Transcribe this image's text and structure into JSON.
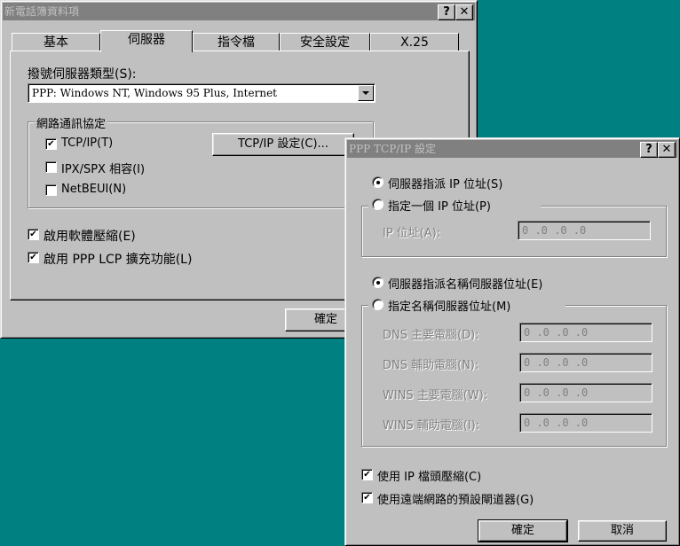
{
  "main_window": {
    "title": "新電話簿資料項",
    "help_label": "?",
    "close_label": "✕",
    "tabs": [
      {
        "label": "基本",
        "active": false
      },
      {
        "label": "伺服器",
        "active": true
      },
      {
        "label": "指令檔",
        "active": false
      },
      {
        "label": "安全設定",
        "active": false
      },
      {
        "label": "X.25",
        "active": false
      }
    ],
    "server_type_label": "撥號伺服器類型(S):",
    "server_type_value": "PPP: Windows NT, Windows 95 Plus, Internet",
    "protocol_group_label": "網路通訊協定",
    "protocols": [
      {
        "label": "TCP/IP(T)",
        "checked": true
      },
      {
        "label": "IPX/SPX 相容(I)",
        "checked": false
      },
      {
        "label": "NetBEUI(N)",
        "checked": false
      }
    ],
    "tcpip_settings_button": "TCP/IP 設定(C)...",
    "software_compression": {
      "label": "啟用軟體壓縮(E)",
      "checked": true
    },
    "ppp_lcp": {
      "label": "啟用 PPP LCP 擴充功能(L)",
      "checked": true
    },
    "ok_button": "確定"
  },
  "tcpip_dialog": {
    "title": "PPP TCP/IP 設定",
    "help_label": "?",
    "close_label": "✕",
    "ip_server_assigned": {
      "label": "伺服器指派 IP 位址(S)",
      "selected": true
    },
    "ip_specify": {
      "label": "指定一個 IP 位址(P)",
      "selected": false
    },
    "ip_address_label": "IP 位址(A):",
    "ip_address_value": "0   .0   .0   .0",
    "dns_server_assigned": {
      "label": "伺服器指派名稱伺服器位址(E)",
      "selected": true
    },
    "dns_specify": {
      "label": "指定名稱伺服器位址(M)",
      "selected": false
    },
    "dns_primary_label": "DNS 主要電腦(D):",
    "dns_primary_value": "0   .0   .0   .0",
    "dns_secondary_label": "DNS 輔助電腦(N):",
    "dns_secondary_value": "0   .0   .0   .0",
    "wins_primary_label": "WINS 主要電腦(W):",
    "wins_primary_value": "0   .0   .0   .0",
    "wins_secondary_label": "WINS 輔助電腦(I):",
    "wins_secondary_value": "0   .0   .0   .0",
    "ip_header_compression": {
      "label": "使用 IP 檔頭壓縮(C)",
      "checked": true
    },
    "default_gateway": {
      "label": "使用遠端網路的預設閘道器(G)",
      "checked": true
    },
    "ok_button": "確定",
    "cancel_button": "取消"
  }
}
